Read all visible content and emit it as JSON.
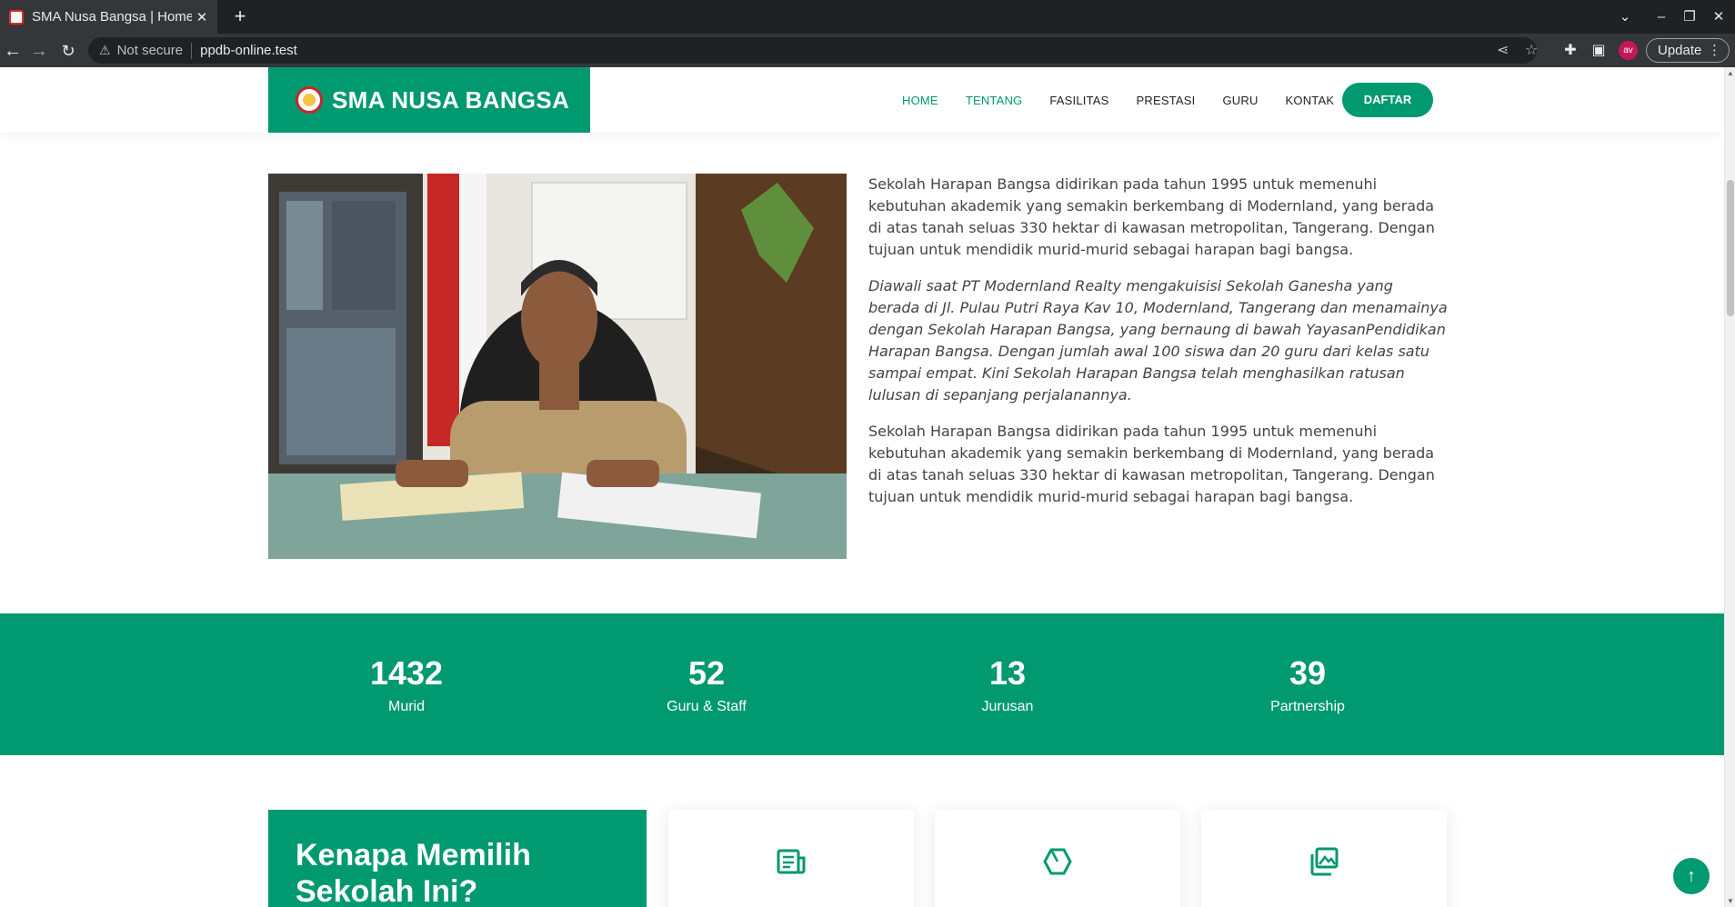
{
  "browser": {
    "tab_title": "SMA Nusa Bangsa | Home",
    "tab_close": "✕",
    "new_tab": "+",
    "security_label": "Not secure",
    "url": "ppdb-online.test",
    "profile_initials": "av",
    "update_label": "Update"
  },
  "site": {
    "brand": "SMA NUSA BANGSA",
    "menu": [
      "HOME",
      "TENTANG",
      "FASILITAS",
      "PRESTASI",
      "GURU",
      "KONTAK"
    ],
    "active_menu": "TENTANG",
    "cta": "DAFTAR",
    "accent_color": "#009970"
  },
  "about": {
    "paragraphs": [
      "Sekolah Harapan Bangsa didirikan pada tahun 1995 untuk memenuhi kebutuhan akademik yang semakin berkembang di Modernland, yang berada di atas tanah seluas 330 hektar di kawasan metropolitan, Tangerang. Dengan tujuan untuk mendidik murid-murid sebagai harapan bagi bangsa.",
      "Diawali saat PT Modernland Realty mengakuisisi Sekolah Ganesha yang berada di Jl. Pulau Putri Raya Kav 10, Modernland, Tangerang dan menamainya dengan Sekolah Harapan Bangsa, yang bernaung di bawah YayasanPendidikan Harapan Bangsa. Dengan jumlah awal 100 siswa dan 20 guru dari kelas satu sampai empat. Kini Sekolah Harapan Bangsa telah menghasilkan ratusan lulusan di sepanjang perjalanannya.",
      "Sekolah Harapan Bangsa didirikan pada tahun 1995 untuk memenuhi kebutuhan akademik yang semakin berkembang di Modernland, yang berada di atas tanah seluas 330 hektar di kawasan metropolitan, Tangerang. Dengan tujuan untuk mendidik murid-murid sebagai harapan bagi bangsa."
    ]
  },
  "stats": [
    {
      "value": "1432",
      "label": "Murid"
    },
    {
      "value": "52",
      "label": "Guru & Staff"
    },
    {
      "value": "13",
      "label": "Jurusan"
    },
    {
      "value": "39",
      "label": "Partnership"
    }
  ],
  "why": {
    "title": "Kenapa Memilih Sekolah Ini?"
  },
  "feature_icons": [
    "newspaper-icon",
    "hexagon-icon",
    "images-icon"
  ],
  "back_to_top": "↑"
}
